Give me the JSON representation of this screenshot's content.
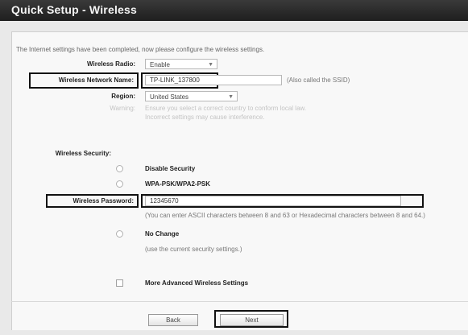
{
  "header": {
    "title": "Quick Setup - Wireless"
  },
  "intro": "The Internet settings have been completed, now please configure the wireless settings.",
  "radio": {
    "label": "Wireless Radio:",
    "value": "Enable"
  },
  "network_name": {
    "label": "Wireless Network Name:",
    "value": "TP-LINK_137800",
    "hint": "(Also called the SSID)"
  },
  "region": {
    "label": "Region:",
    "value": "United States",
    "warning_label": "Warning:",
    "warning_line1": "Ensure you select a correct country to conform local law.",
    "warning_line2": "Incorrect settings may cause interference."
  },
  "security": {
    "label": "Wireless Security:",
    "options": [
      {
        "label": "Disable Security"
      },
      {
        "label": "WPA-PSK/WPA2-PSK"
      }
    ],
    "password_label": "Wireless Password:",
    "password_value": "12345670",
    "password_hint": "(You can enter ASCII characters between 8 and 63 or Hexadecimal characters between 8 and 64.)",
    "no_change_label": "No Change",
    "no_change_hint": "(use the current security settings.)"
  },
  "advanced": {
    "label": "More Advanced Wireless Settings"
  },
  "buttons": {
    "back": "Back",
    "next": "Next"
  }
}
